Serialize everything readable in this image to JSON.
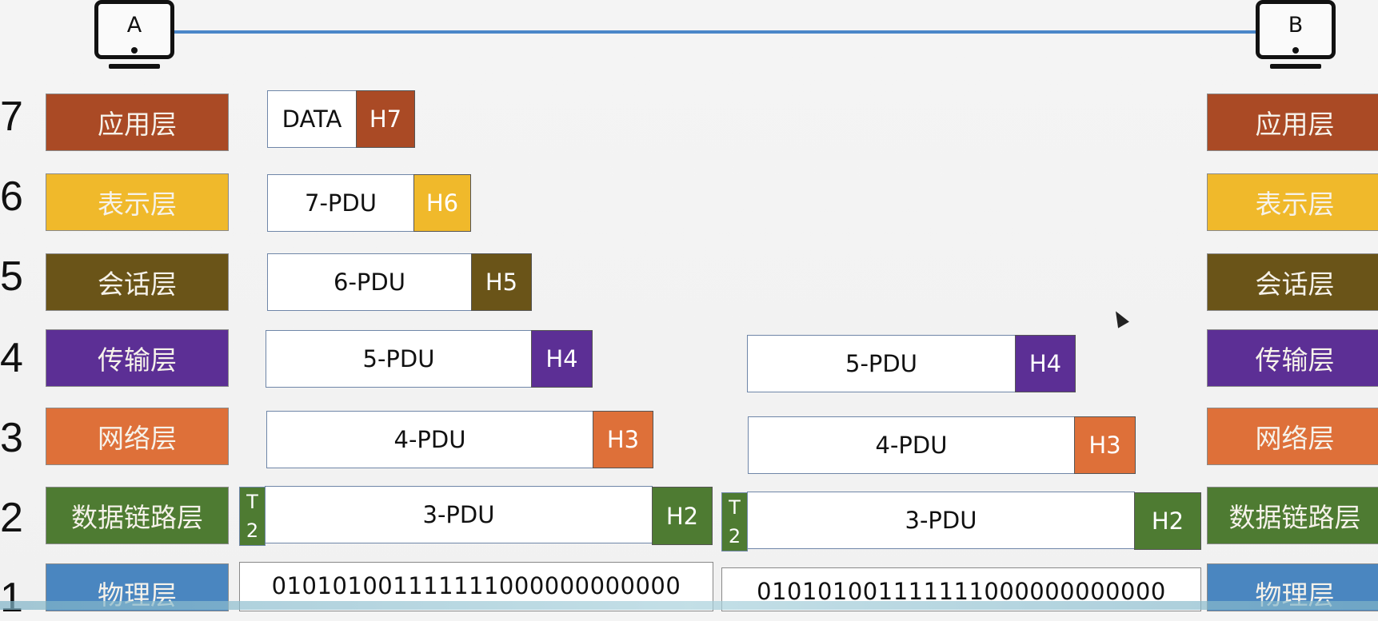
{
  "hosts": {
    "left": "A",
    "right": "B"
  },
  "colors": {
    "app": "#aa4a25",
    "pres": "#f0b92b",
    "sess": "#6a5418",
    "trans": "#5c2f95",
    "net": "#de7039",
    "link": "#4e7b32",
    "phys": "#4a86c0",
    "wire": "#4a86c8"
  },
  "layers": [
    {
      "num": "7",
      "name": "应用层",
      "color": "#aa4a25"
    },
    {
      "num": "6",
      "name": "表示层",
      "color": "#f0b92b"
    },
    {
      "num": "5",
      "name": "会话层",
      "color": "#6a5418"
    },
    {
      "num": "4",
      "name": "传输层",
      "color": "#5c2f95"
    },
    {
      "num": "3",
      "name": "网络层",
      "color": "#de7039"
    },
    {
      "num": "2",
      "name": "数据链路层",
      "color": "#4e7b32"
    },
    {
      "num": "1",
      "name": "物理层",
      "color": "#4a86c0"
    }
  ],
  "sender": {
    "l7": {
      "data": "DATA",
      "header": "H7"
    },
    "l6": {
      "data": "7-PDU",
      "header": "H6"
    },
    "l5": {
      "data": "6-PDU",
      "header": "H5"
    },
    "l4": {
      "data": "5-PDU",
      "header": "H4"
    },
    "l3": {
      "data": "4-PDU",
      "header": "H3"
    },
    "l2": {
      "data": "3-PDU",
      "header": "H2",
      "trailer_top": "T",
      "trailer_bottom": "2"
    },
    "l1": {
      "bits": "010101001111111000000000000"
    }
  },
  "receiver": {
    "l4": {
      "data": "5-PDU",
      "header": "H4"
    },
    "l3": {
      "data": "4-PDU",
      "header": "H3"
    },
    "l2": {
      "data": "3-PDU",
      "header": "H2",
      "trailer_top": "T",
      "trailer_bottom": "2"
    },
    "l1": {
      "bits": "010101001111111000000000000"
    }
  }
}
